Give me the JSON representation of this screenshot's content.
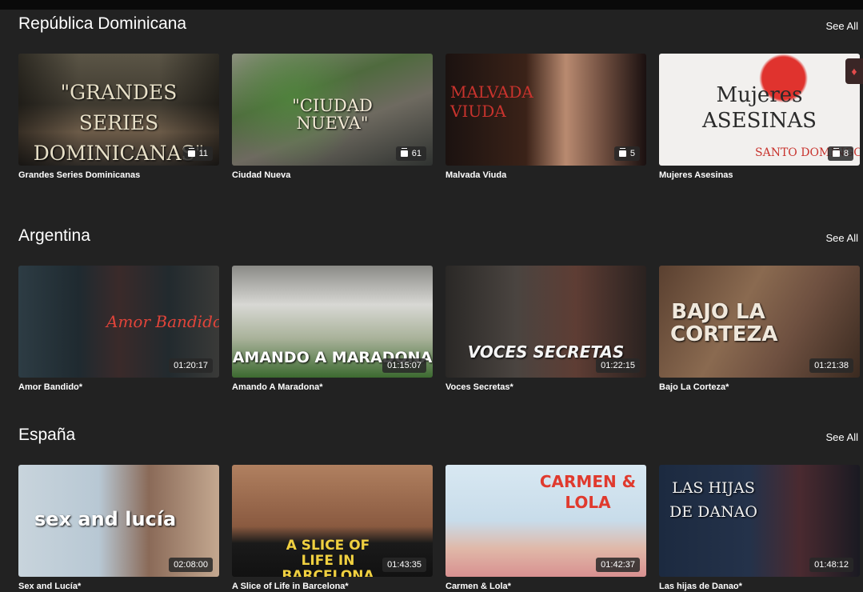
{
  "sections": [
    {
      "title": "República Dominicana",
      "see_all": "See All",
      "items": [
        {
          "title": "Grandes Series Dominicanas",
          "badge": "11",
          "art_text": "\"GRANDES SERIES DOMINICANAS\""
        },
        {
          "title": "Ciudad Nueva",
          "badge": "61",
          "art_text": "\"CIUDAD NUEVA\""
        },
        {
          "title": "Malvada Viuda",
          "badge": "5",
          "art_text": "MALVADA VIUDA"
        },
        {
          "title": "Mujeres Asesinas",
          "badge": "8",
          "art_text": "Mujeres ASESINAS",
          "art_sub": "SANTO DOMINGO"
        }
      ]
    },
    {
      "title": "Argentina",
      "see_all": "See All",
      "items": [
        {
          "title": "Amor Bandido*",
          "badge": "01:20:17",
          "art_text": "Amor Bandido"
        },
        {
          "title": "Amando A Maradona*",
          "badge": "01:15:07",
          "art_text": "AMANDO A MARADONA"
        },
        {
          "title": "Voces Secretas*",
          "badge": "01:22:15",
          "art_text": "VOCES SECRETAS"
        },
        {
          "title": "Bajo La Corteza*",
          "badge": "01:21:38",
          "art_text": "BAJO LA CORTEZA"
        }
      ]
    },
    {
      "title": "España",
      "see_all": "See All",
      "items": [
        {
          "title": "Sex and Lucía*",
          "badge": "02:08:00",
          "art_text": "sex and lucía"
        },
        {
          "title": "A Slice of Life in Barcelona*",
          "badge": "01:43:35",
          "art_text": "A SLICE OF LIFE IN BARCELONA"
        },
        {
          "title": "Carmen & Lola*",
          "badge": "01:42:37",
          "art_text": "CARMEN & LOLA"
        },
        {
          "title": "Las hijas de Danao*",
          "badge": "01:48:12",
          "art_text": "LAS HIJAS DE DANAO"
        }
      ]
    }
  ],
  "colors": {
    "background": "#222222",
    "text": "#ffffff",
    "badge_bg": "#282828"
  },
  "icons": {
    "episodes": "stack-icon",
    "notification": "bell-icon"
  }
}
